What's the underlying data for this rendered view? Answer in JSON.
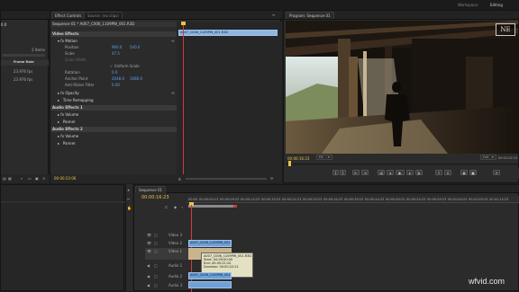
{
  "menu": {
    "workspace_label": "Workspace:",
    "workspace_value": "Editing"
  },
  "project_panel": {
    "frame_rate_header": "Frame Rate",
    "frame_rates": [
      "23.976 fps",
      "23.976 fps"
    ],
    "left_fragments": [
      "0.0",
      "2 Items"
    ]
  },
  "effect_controls": {
    "tab_active": "Effect Controls",
    "tab_inactive": "Source: (no clips)",
    "breadcrumb": "Sequence 01 * A007_C006_1109PW_001.R3D",
    "time": "00:00:16:23",
    "clip_label": "A007_C006_1109PW_001.R3D",
    "video_effects": "Video Effects",
    "motion": "Motion",
    "position_label": "Position",
    "position_values": [
      "960.0",
      "540.0"
    ],
    "scale_label": "Scale",
    "scale_value": "47.5",
    "scale_width_label": "Scale Width",
    "uniform_scale": "Uniform Scale",
    "rotation_label": "Rotation",
    "rotation_value": "0.0",
    "anchor_label": "Anchor Point",
    "anchor_values": [
      "2048.0",
      "1080.0"
    ],
    "antiflicker_label": "Anti-flicker Filter",
    "antiflicker_value": "0.00",
    "opacity": "Opacity",
    "time_remap": "Time Remapping",
    "audio_effects_1": "Audio Effects 1",
    "volume": "Volume",
    "panner": "Panner",
    "audio_effects_2": "Audio Effects 2",
    "volume2": "Volume",
    "panner2": "Panner",
    "bottom_time": "00:00:23:06"
  },
  "program_monitor": {
    "tab": "Program: Sequence 01",
    "timecode": "00:00:16:23",
    "fit": "Fit",
    "quality": "Full",
    "duration": "00:01:02:13",
    "watermark": "NE"
  },
  "timeline": {
    "tab": "Sequence 01",
    "timecode": "00:00:16:23",
    "ruler": [
      "00:00",
      "00:00:04:23",
      "00:00:09:23",
      "00:00:14:23",
      "00:00:19:23",
      "00:00:24:23",
      "00:00:29:23",
      "00:00:34:23",
      "00:00:39:23",
      "00:00:44:23",
      "00:00:49:23",
      "00:00:54:23",
      "00:00:59:23",
      "00:01:04:23",
      "00:01:09:23",
      "00:01:14:23"
    ],
    "tracks": [
      "Video 3",
      "Video 2",
      "Video 1",
      "Audio 1",
      "Audio 2",
      "Audio 3"
    ],
    "clip_name": "A007_C006_1109PW_001.R3D",
    "clip_name_short": "A007_C006_1109PW_001",
    "tooltip": {
      "title": "A007_C006_1109PW_001.R3D",
      "start": "Start: 00:00:00:00",
      "end": "End: 00:00:22:20",
      "duration": "Duration: 00:00:22:21"
    }
  },
  "watermark": "wfvid.com",
  "colors": {
    "accent_blue": "#5ca3e6",
    "clip_blue": "#6fa0d6",
    "timecode_yellow": "#e8c34a",
    "playhead_red": "#d23a3a"
  }
}
